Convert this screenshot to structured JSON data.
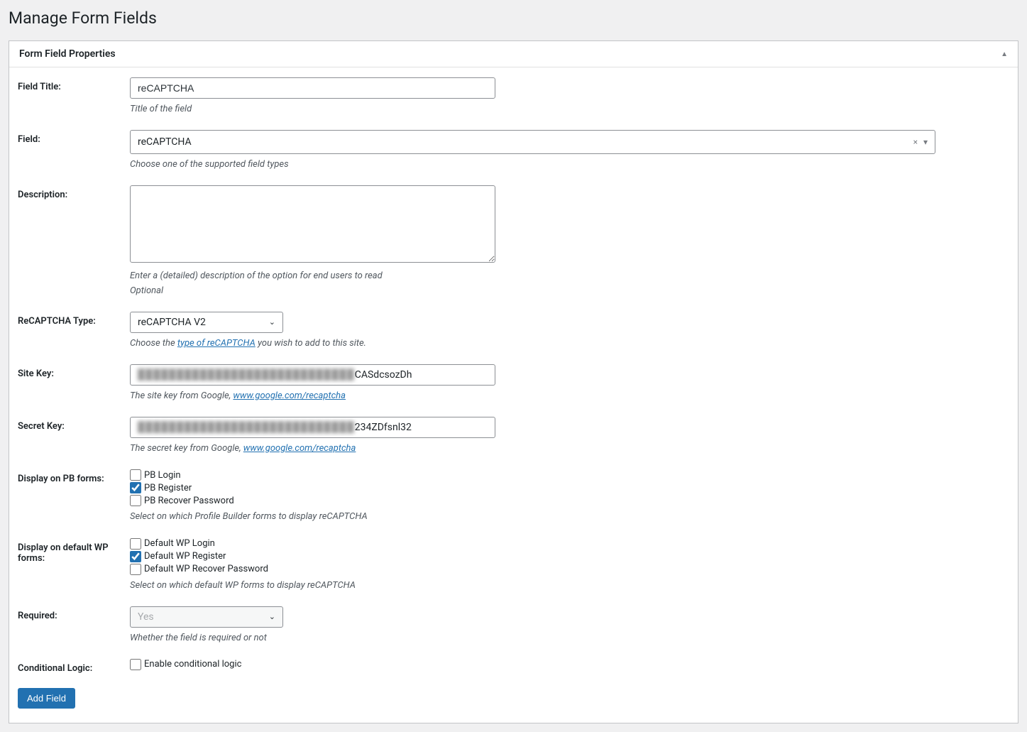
{
  "page": {
    "title": "Manage Form Fields"
  },
  "panel": {
    "header": "Form Field Properties"
  },
  "fields": {
    "field_title": {
      "label": "Field Title:",
      "value": "reCAPTCHA",
      "help": "Title of the field"
    },
    "field_type": {
      "label": "Field:",
      "value": "reCAPTCHA",
      "help": "Choose one of the supported field types"
    },
    "description": {
      "label": "Description:",
      "value": "",
      "help1": "Enter a (detailed) description of the option for end users to read",
      "help2": "Optional"
    },
    "recaptcha_type": {
      "label": "ReCAPTCHA Type:",
      "value": "reCAPTCHA V2",
      "help_prefix": "Choose the ",
      "help_link": "type of reCAPTCHA",
      "help_suffix": " you wish to add to this site."
    },
    "site_key": {
      "label": "Site Key:",
      "blurred": "████████████████████████████",
      "visible": "CASdcsozDh",
      "help_prefix": "The site key from Google, ",
      "help_link": "www.google.com/recaptcha"
    },
    "secret_key": {
      "label": "Secret Key:",
      "blurred": "████████████████████████████",
      "visible": "234ZDfsnl32",
      "help_prefix": "The secret key from Google, ",
      "help_link": "www.google.com/recaptcha"
    },
    "display_pb": {
      "label": "Display on PB forms:",
      "opt1": "PB Login",
      "opt2": "PB Register",
      "opt3": "PB Recover Password",
      "help": "Select on which Profile Builder forms to display reCAPTCHA"
    },
    "display_wp": {
      "label": "Display on default WP forms:",
      "opt1": "Default WP Login",
      "opt2": "Default WP Register",
      "opt3": "Default WP Recover Password",
      "help": "Select on which default WP forms to display reCAPTCHA"
    },
    "required": {
      "label": "Required:",
      "value": "Yes",
      "help": "Whether the field is required or not"
    },
    "conditional": {
      "label": "Conditional Logic:",
      "opt": "Enable conditional logic"
    }
  },
  "buttons": {
    "add": "Add Field"
  }
}
